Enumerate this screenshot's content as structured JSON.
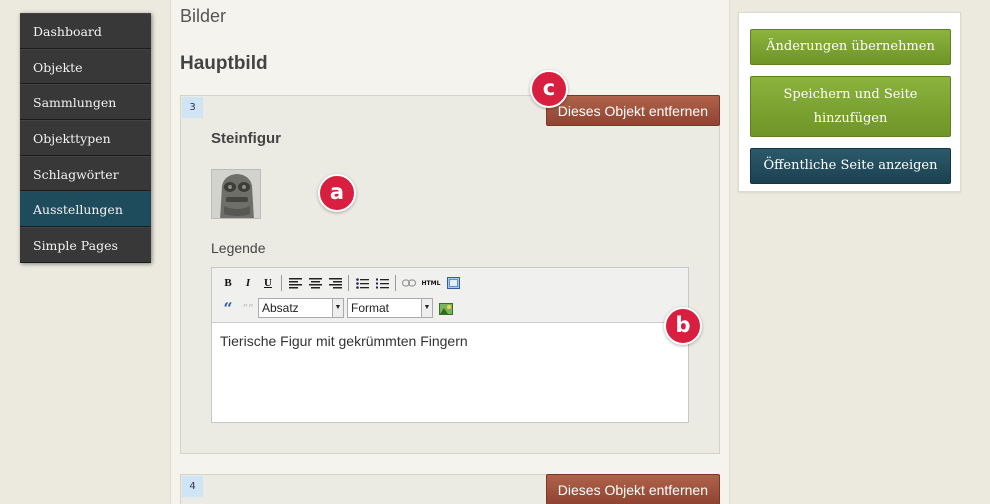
{
  "sidebar": {
    "items": [
      {
        "label": "Dashboard"
      },
      {
        "label": "Objekte"
      },
      {
        "label": "Sammlungen"
      },
      {
        "label": "Objekttypen"
      },
      {
        "label": "Schlagwörter"
      },
      {
        "label": "Ausstellungen",
        "active": true
      },
      {
        "label": "Simple Pages"
      }
    ]
  },
  "main": {
    "section_title": "Bilder",
    "subsection_title": "Hauptbild",
    "blocks": [
      {
        "number": "3",
        "remove_label": "Dieses Objekt entfernen",
        "item_title": "Steinfigur",
        "caption_label": "Legende",
        "editor": {
          "toolbar": {
            "bold": "B",
            "italic": "I",
            "underline": "U",
            "html": "HTML",
            "paragraph_select": "Absatz",
            "format_select": "Format"
          },
          "content": "Tierische Figur mit gekrümmten Fingern"
        }
      },
      {
        "number": "4",
        "remove_label": "Dieses Objekt entfernen"
      }
    ]
  },
  "actions": {
    "apply_label": "Änderungen übernehmen",
    "save_add_label": "Speichern und Seite hinzufügen",
    "view_public_label": "Öffentliche Seite anzeigen"
  },
  "markers": {
    "a": "a",
    "b": "b",
    "c": "c"
  },
  "colors": {
    "accent_green": "#7ba330",
    "remove_button": "#9d4c37",
    "active_nav": "#1f4c5c",
    "marker": "#d81f3f"
  }
}
